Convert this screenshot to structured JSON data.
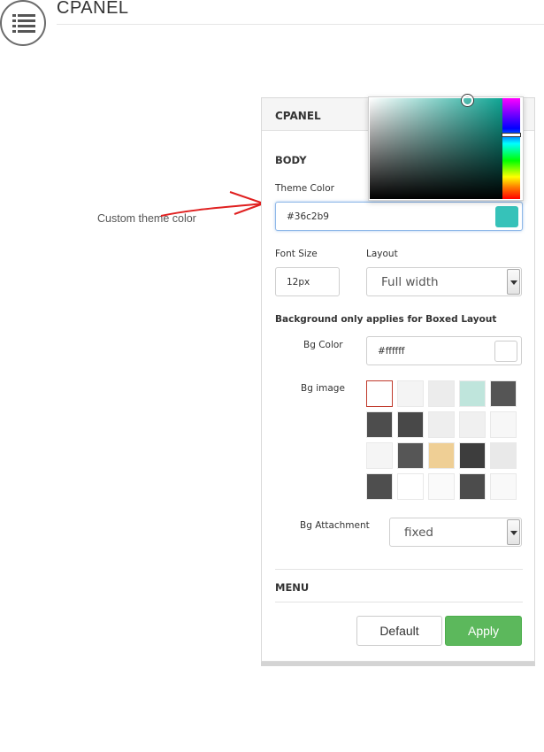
{
  "page": {
    "title": "CPANEL"
  },
  "annotation": {
    "text": "Custom theme color"
  },
  "panel": {
    "title": "CPANEL",
    "body_heading": "BODY",
    "theme_color": {
      "label": "Theme Color",
      "value": "#36c2b9",
      "swatch": "#36c2b9"
    },
    "font_size": {
      "label": "Font Size",
      "value": "12px"
    },
    "layout": {
      "label": "Layout",
      "value": "Full width"
    },
    "bg_note": "Background only applies for Boxed Layout",
    "bg_color": {
      "label": "Bg Color",
      "value": "#ffffff",
      "swatch": "#ffffff"
    },
    "bg_image": {
      "label": "Bg image",
      "tiles": [
        "#ffffff",
        "#f4f4f4",
        "#ececec",
        "#bfe5dc",
        "#555555",
        "#4d4d4d",
        "#484848",
        "#eeeeee",
        "#f0f0f0",
        "#f7f7f7",
        "#f5f5f5",
        "#565656",
        "#efcf95",
        "#3d3d3d",
        "#e9e9e9",
        "#4e4e4e",
        "#ffffff",
        "#fafafa",
        "#4c4c4c",
        "#f9f9f9"
      ],
      "selected_index": 0
    },
    "bg_attachment": {
      "label": "Bg Attachment",
      "value": "fixed"
    },
    "menu_heading": "MENU",
    "buttons": {
      "default": "Default",
      "apply": "Apply"
    }
  },
  "color_picker": {
    "hue_color": "#0fa594"
  },
  "colors": {
    "accent_green": "#5cb85c",
    "arrow_red": "#e02020"
  }
}
